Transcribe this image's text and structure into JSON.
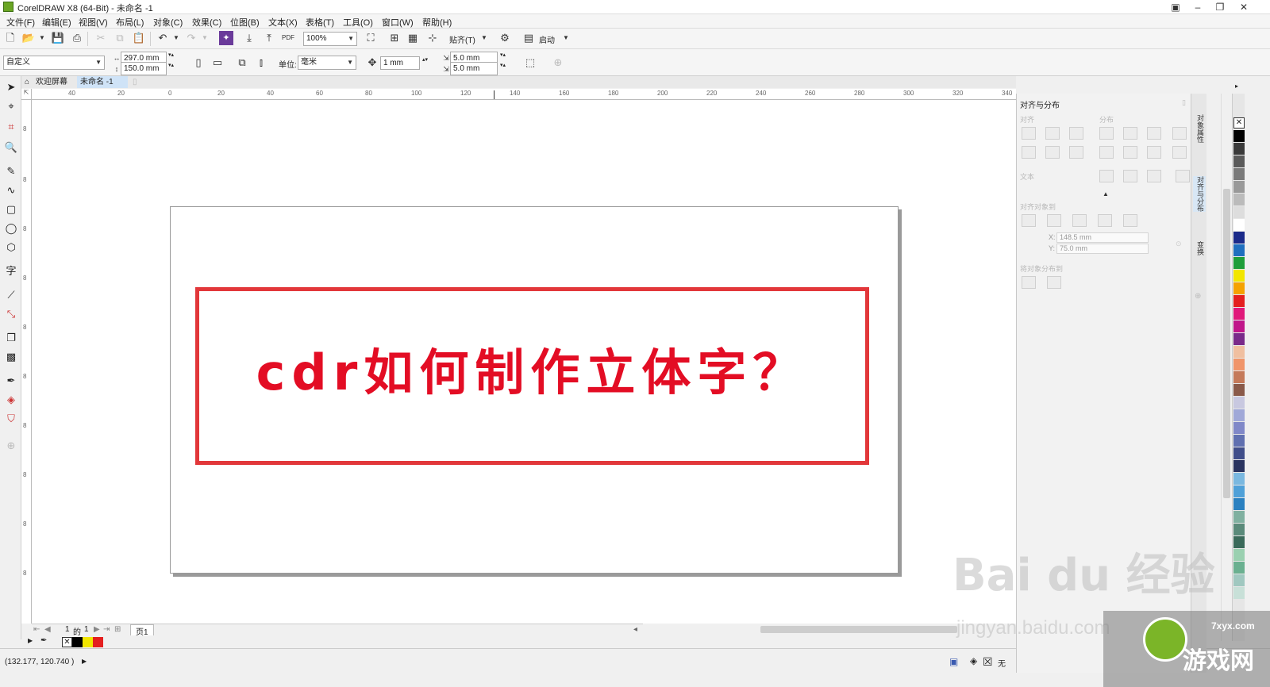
{
  "window": {
    "title": "CorelDRAW X8 (64-Bit) - 未命名 -1",
    "controls": [
      "▣",
      "–",
      "❐",
      "✕"
    ]
  },
  "menu": [
    "文件(F)",
    "编辑(E)",
    "视图(V)",
    "布局(L)",
    "对象(C)",
    "效果(C)",
    "位图(B)",
    "文本(X)",
    "表格(T)",
    "工具(O)",
    "窗口(W)",
    "帮助(H)"
  ],
  "toolbar": {
    "zoom": "100%",
    "pdf_label": "PDF",
    "snap": "贴齐(T)",
    "launch": "启动"
  },
  "propbar": {
    "page_preset": "自定义",
    "width": "297.0 mm",
    "height": "150.0 mm",
    "units_label": "单位:",
    "units": "毫米",
    "nudge": "1 mm",
    "dup_x": "5.0 mm",
    "dup_y": "5.0 mm"
  },
  "tabs": {
    "welcome": "欢迎屏幕",
    "document": "未命名 -1"
  },
  "ruler": {
    "h_ticks": [
      "40",
      "20",
      "0",
      "20",
      "40",
      "60",
      "80",
      "100",
      "120",
      "140",
      "160",
      "180",
      "200",
      "220",
      "240",
      "260",
      "280",
      "300",
      "320",
      "340",
      "360"
    ],
    "unit": "毫米",
    "v_ticks": [
      "8",
      "8",
      "8",
      "8",
      "8",
      "8",
      "8",
      "8",
      "8",
      "8",
      "8"
    ]
  },
  "canvas": {
    "headline": "cdr如何制作立体字？"
  },
  "pager": {
    "current": "1",
    "of_label": "的",
    "total": "1",
    "page_tab": "页1"
  },
  "status": {
    "coords": "(132.177, 120.740 )",
    "fill_none": "无"
  },
  "docker": {
    "title": "对齐与分布",
    "sec_align": "对齐",
    "sec_distribute": "分布",
    "sec_text": "文本",
    "sec_align_to": "对齐对象到",
    "x_value": "148.5 mm",
    "y_value": "75.0 mm",
    "x_label": "X:",
    "y_label": "Y:",
    "sec_distribute_to": "将对象分布到",
    "tabs": [
      "对象属性",
      "对齐与分布",
      "变换"
    ]
  },
  "palette_colors": [
    "#000000",
    "#3a3a3a",
    "#5a5a5a",
    "#7a7a7a",
    "#999999",
    "#bbbbbb",
    "#dddddd",
    "#ffffff",
    "#1a2a8a",
    "#1f6fbf",
    "#1f9e3a",
    "#f2e600",
    "#f5a200",
    "#e41f1f",
    "#e0197a",
    "#c0168a",
    "#7a2a8a",
    "#f0bfa0",
    "#f0956a",
    "#c57a5a",
    "#8a5a4a",
    "#c8c8e0",
    "#a0a8d8",
    "#8088c8",
    "#6070b0",
    "#404e8a",
    "#2a3460",
    "#7ab8e0",
    "#4fa0d8",
    "#2a80c0",
    "#80b0a0",
    "#5a8a7a",
    "#3a6a5a",
    "#9ad0b0",
    "#6ab090",
    "#a0c8c0",
    "#c8e0d8"
  ],
  "watermark": {
    "main": "Bai du 经验",
    "sub": "jingyan.baidu.com",
    "game": "游戏网",
    "game_site": "7xyx.com"
  },
  "colors": {
    "frame": "#e2373a",
    "text": "#e30d24"
  }
}
